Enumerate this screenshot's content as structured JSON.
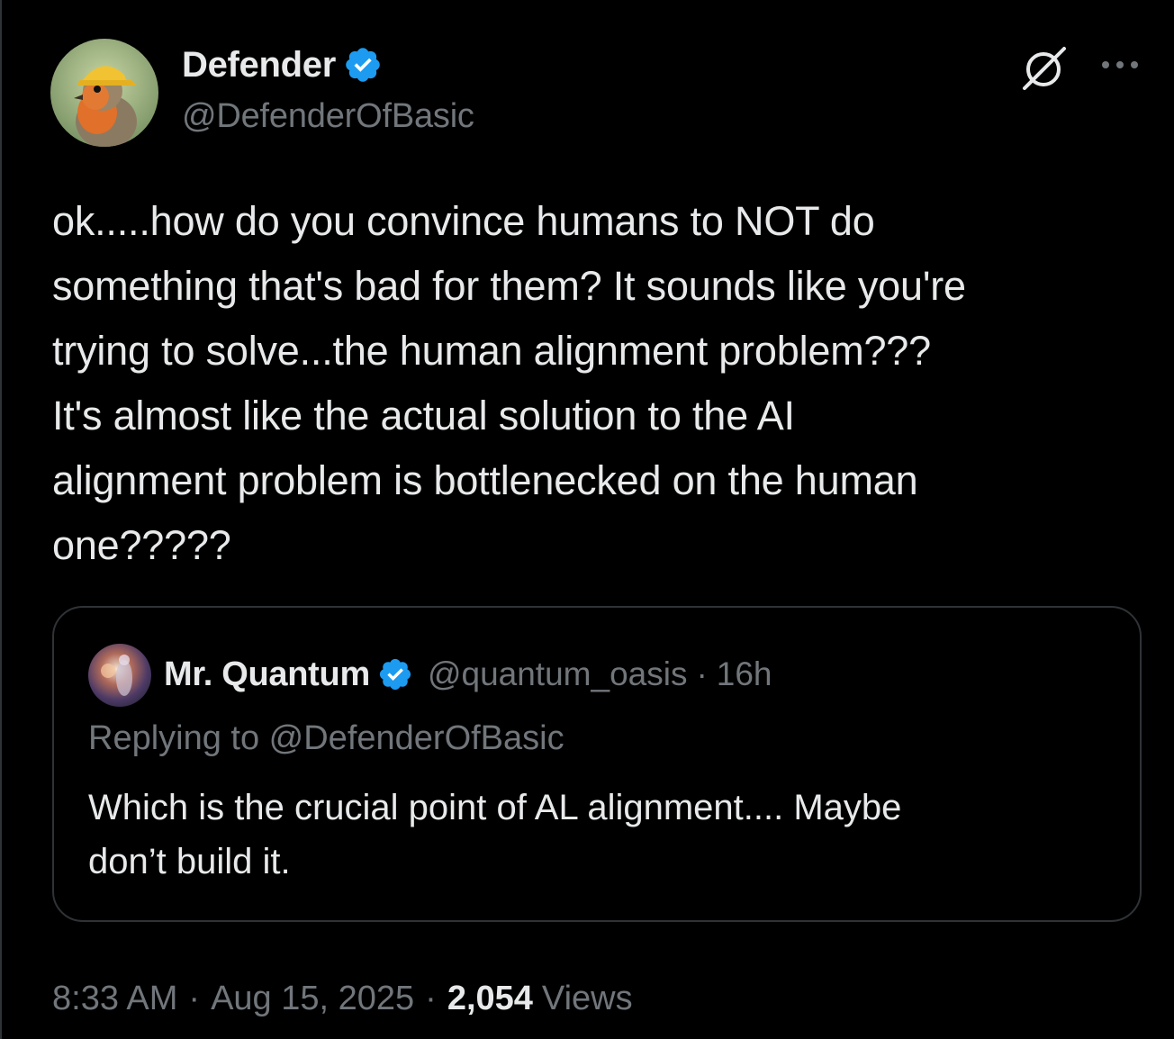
{
  "colors": {
    "background": "#000000",
    "text": "#e7e9ea",
    "muted": "#71767b",
    "border": "#2f3336",
    "verified": "#1d9bf0"
  },
  "author": {
    "name": "Defender",
    "handle": "@DefenderOfBasic",
    "avatar_icon": "robin-with-yellow-cap-avatar",
    "verified_icon": "verified-badge-icon"
  },
  "header_actions": {
    "grok_icon": "grok-icon",
    "more_icon": "more-options-icon"
  },
  "tweet": {
    "text": "ok.....how do you convince humans to NOT do\nsomething that's bad for them? It sounds like you're\ntrying to solve...the human alignment problem???\nIt's almost like the actual solution to the AI\nalignment problem is bottlenecked on the human\none?????"
  },
  "quote": {
    "name": "Mr. Quantum",
    "handle": "@quantum_oasis",
    "separator": "·",
    "time": "16h",
    "replying_to": "Replying to @DefenderOfBasic",
    "text": "Which is the crucial point of AL alignment.... Maybe\ndon’t build it."
  },
  "meta": {
    "time": "8:33 AM",
    "date": "Aug 15, 2025",
    "separator": "·",
    "views_count": "2,054",
    "views_label": "Views"
  }
}
